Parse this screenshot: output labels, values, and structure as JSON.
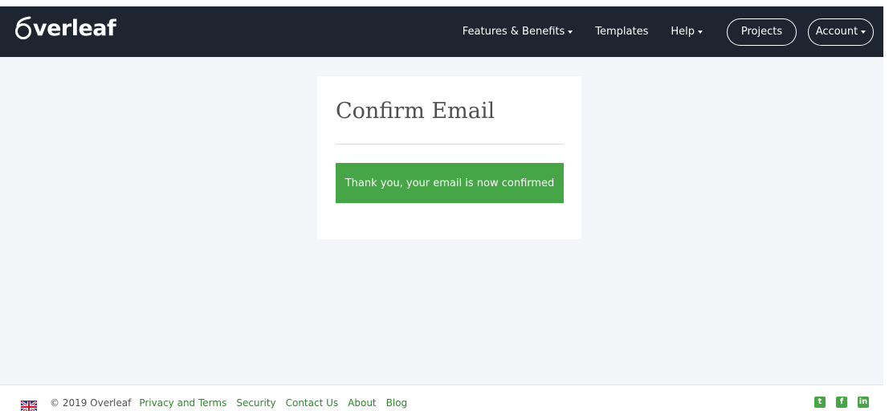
{
  "brand": {
    "name": "verleaf"
  },
  "nav": {
    "features_label": "Features & Benefits",
    "templates_label": "Templates",
    "help_label": "Help",
    "projects_label": "Projects",
    "account_label": "Account"
  },
  "card": {
    "title": "Confirm Email",
    "alert_text": "Thank you, your email is now confirmed"
  },
  "footer": {
    "copyright": "© 2019 Overleaf",
    "links": [
      "Privacy and Terms",
      "Security",
      "Contact Us",
      "About",
      "Blog"
    ]
  },
  "social": {
    "twitter_glyph": "t",
    "facebook_glyph": "f",
    "linkedin_glyph": "in"
  },
  "colors": {
    "navbar": "#1e2530",
    "page_bg": "#f4f5f8",
    "success": "#46a546",
    "link": "#2b8a2b"
  }
}
